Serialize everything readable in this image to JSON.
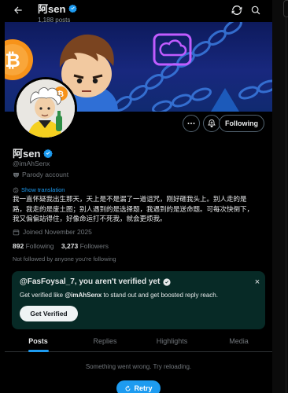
{
  "header": {
    "title": "阿sen",
    "posts_count": "1,188 posts"
  },
  "profile": {
    "name": "阿sen",
    "handle": "@imAhSenx",
    "parody_label": "Parody account",
    "show_translation": "Show translation",
    "bio_lines": [
      "我一直怀疑我出生那天，天上是不是漏了一道诅咒，刚好砸我头上。别人走的是",
      "路，我走的是废土图；别人遇到的是选择题，我遇到的是送命题。可每次快倒下，",
      "我又偏偏站得住，好像命运打不死我，就会更烦我。"
    ],
    "joined": "Joined November 2025",
    "following_count": "892",
    "following_label": "Following",
    "followers_count": "3,273",
    "followers_label": "Followers",
    "not_followed": "Not followed by anyone you're following",
    "follow_button": "Following"
  },
  "verify_card": {
    "title": "@FasFoysal_7, you aren't verified yet",
    "desc_prefix": "Get verified like ",
    "desc_handle": "@imAhSenx",
    "desc_suffix": " to stand out and get boosted reply reach.",
    "button": "Get Verified",
    "close": "×"
  },
  "tabs": [
    {
      "label": "Posts"
    },
    {
      "label": "Replies"
    },
    {
      "label": "Highlights"
    },
    {
      "label": "Media"
    }
  ],
  "feed": {
    "error": "Something went wrong. Try reloading.",
    "retry": "Retry"
  },
  "colors": {
    "accent": "#1d9bf0",
    "verified": "#1d9bf0",
    "card_bg": "#072a26"
  },
  "icons": [
    "back-arrow-icon",
    "refresh-icon",
    "search-icon",
    "verified-badge-icon",
    "more-icon",
    "subscribe-icon",
    "parody-mask-icon",
    "translate-icon",
    "calendar-icon",
    "close-icon",
    "retry-icon"
  ]
}
